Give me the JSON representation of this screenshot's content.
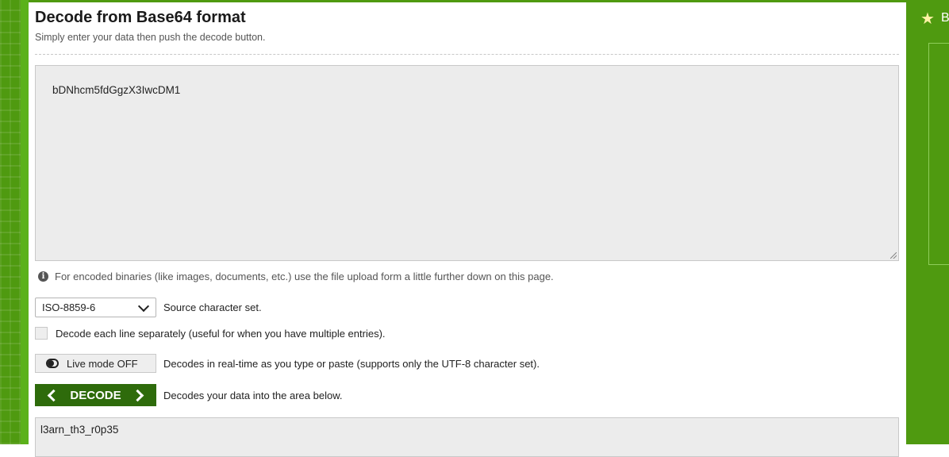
{
  "header": {
    "title": "Decode from Base64 format",
    "subtitle": "Simply enter your data then push the decode button."
  },
  "input": {
    "value": "bDNhcm5fdGgzX3IwcDM1"
  },
  "info": {
    "text": "For encoded binaries (like images, documents, etc.) use the file upload form a little further down on this page."
  },
  "charset": {
    "selected": "ISO-8859-6",
    "label": "Source character set."
  },
  "line_mode": {
    "label": "Decode each line separately (useful for when you have multiple entries).",
    "checked": false
  },
  "live_mode": {
    "button_label": "Live mode OFF",
    "description": "Decodes in real-time as you type or paste (supports only the UTF-8 character set)."
  },
  "decode": {
    "button_label": "DECODE",
    "description": "Decodes your data into the area below."
  },
  "output": {
    "value": "l3arn_th3_r0p35"
  },
  "sidebar": {
    "partial_label": "B"
  },
  "colors": {
    "brand_green": "#4f9a10",
    "decode_button": "#2e6b0b"
  }
}
